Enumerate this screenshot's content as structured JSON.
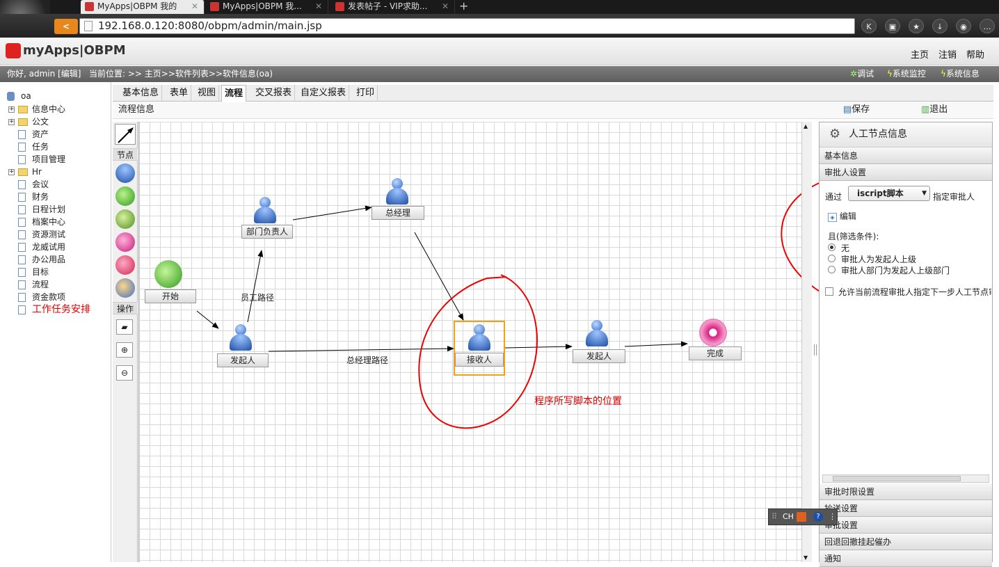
{
  "browser": {
    "tabs": [
      {
        "title": "MyApps|OBPM 我的",
        "active": true
      },
      {
        "title": "MyApps|OBPM 我...",
        "active": false
      },
      {
        "title": "发表帖子 - VIP求助...",
        "active": false
      }
    ],
    "url": "192.168.0.120:8080/obpm/admin/main.jsp"
  },
  "app": {
    "logo_text": "myApps|OBPM",
    "top_links": [
      "主页",
      "注销",
      "帮助"
    ],
    "greeting": "你好, admin [编辑]",
    "location": "当前位置: >> 主页>>软件列表>>软件信息(oa)",
    "sub_links": [
      "调试",
      "系统监控",
      "系统信息"
    ]
  },
  "sidebar": {
    "root": "oa",
    "items": [
      {
        "label": "信息中心",
        "type": "folder"
      },
      {
        "label": "公文",
        "type": "folder"
      },
      {
        "label": "资产",
        "type": "doc"
      },
      {
        "label": "任务",
        "type": "doc"
      },
      {
        "label": "项目管理",
        "type": "doc"
      },
      {
        "label": "Hr",
        "type": "folder"
      },
      {
        "label": "会议",
        "type": "doc"
      },
      {
        "label": "财务",
        "type": "doc"
      },
      {
        "label": "日程计划",
        "type": "doc"
      },
      {
        "label": "档案中心",
        "type": "doc"
      },
      {
        "label": "资源测试",
        "type": "doc"
      },
      {
        "label": "龙威试用",
        "type": "doc"
      },
      {
        "label": "办公用品",
        "type": "doc"
      },
      {
        "label": "目标",
        "type": "doc"
      },
      {
        "label": "流程",
        "type": "doc"
      },
      {
        "label": "资金款项",
        "type": "doc"
      },
      {
        "label": "工作任务安排",
        "type": "doc",
        "highlight": true
      }
    ]
  },
  "tabs": [
    "基本信息",
    "表单",
    "视图",
    "流程",
    "交叉报表",
    "自定义报表",
    "打印"
  ],
  "flow_bar": {
    "title": "流程信息",
    "save": "保存",
    "exit": "退出"
  },
  "toolbox": {
    "node_header": "节点",
    "op_header": "操作"
  },
  "diagram": {
    "nodes": {
      "start": "开始",
      "dept_head": "部门负责人",
      "gm": "总经理",
      "initiator1": "发起人",
      "receiver": "接收人",
      "initiator2": "发起人",
      "finish": "完成"
    },
    "edges": {
      "employee_path": "员工路径",
      "gm_path": "总经理路径"
    },
    "annotation": "程序所写脚本的位置"
  },
  "panel": {
    "title": "人工节点信息",
    "sections": {
      "basic": "基本信息",
      "approver": "审批人设置",
      "time_limit": "审批时限设置",
      "notify_settings": "抄送设置",
      "approve_settings": "审批设置",
      "rollback": "回退回撤挂起催办",
      "notice": "通知"
    },
    "via_label": "通过",
    "via_value": "iscript脚本",
    "assign_label": "指定审批人",
    "edit_label": "编辑",
    "filter_label": "且(筛选条件):",
    "radio_options": [
      "无",
      "审批人为发起人上级",
      "审批人部门为发起人上级部门"
    ],
    "checkbox_label": "允许当前流程审批人指定下一步人工节点审"
  },
  "ime": {
    "label": "CH"
  }
}
